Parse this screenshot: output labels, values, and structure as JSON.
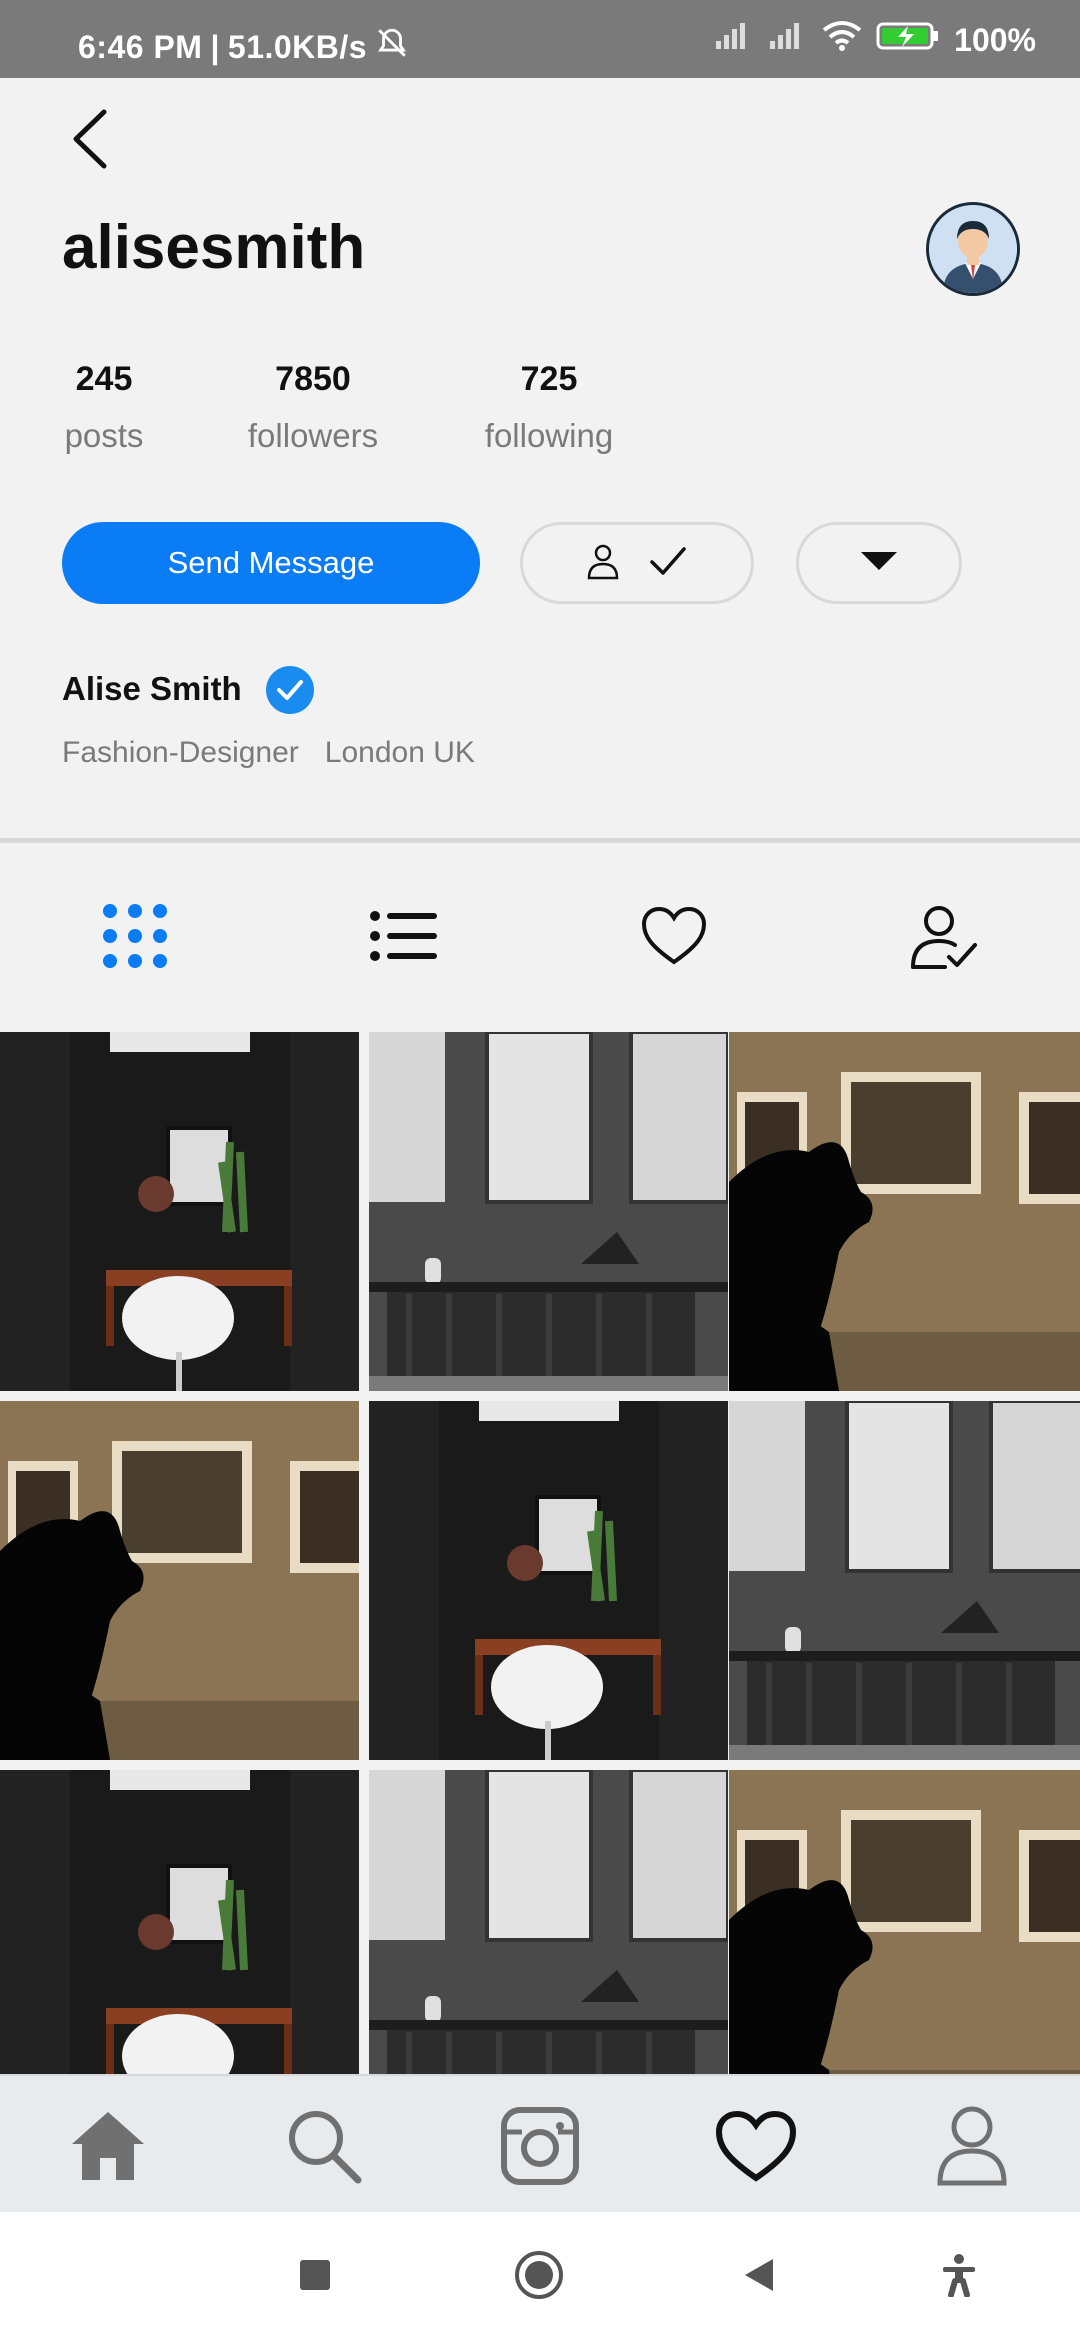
{
  "status_bar": {
    "time": "6:46 PM",
    "net_speed": "51.0KB/s",
    "battery": "100%",
    "icons": [
      "bell-muted-icon",
      "signal-icon",
      "signal-icon",
      "wifi-icon",
      "battery-charging-icon"
    ]
  },
  "header": {
    "back_icon": "chevron-left-icon",
    "username": "alisesmith",
    "avatar_icon": "avatar-businessman-icon"
  },
  "stats": [
    {
      "value": "245",
      "label": "posts"
    },
    {
      "value": "7850",
      "label": "followers"
    },
    {
      "value": "725",
      "label": "following"
    }
  ],
  "actions": {
    "send_message": "Send Message",
    "following_icons": [
      "person-icon",
      "checkmark-icon"
    ],
    "dropdown_icon": "caret-down-icon"
  },
  "profile": {
    "name": "Alise Smith",
    "verified_icon": "verified-check-icon",
    "occupation": "Fashion-Designer",
    "location": "London UK"
  },
  "tabs": [
    {
      "icon": "grid-dots-icon",
      "active": true
    },
    {
      "icon": "list-icon",
      "active": false
    },
    {
      "icon": "heart-icon",
      "active": false
    },
    {
      "icon": "user-check-icon",
      "active": false
    }
  ],
  "grid": {
    "photos": [
      "interior-black-room",
      "interior-grey-frames",
      "silhouette-thinker",
      "silhouette-thinker",
      "interior-black-room",
      "interior-grey-frames",
      "interior-black-room",
      "interior-grey-frames",
      "silhouette-thinker"
    ]
  },
  "bottom_nav": [
    "home-icon",
    "search-icon",
    "camera-icon",
    "heart-icon",
    "profile-icon"
  ],
  "system_nav": [
    "recents-square-icon",
    "home-circle-icon",
    "back-triangle-icon",
    "accessibility-icon"
  ],
  "colors": {
    "accent": "#0a7cf5",
    "verified": "#1a8cf0",
    "muted_text": "#7a7a7a",
    "status_bar": "#7a7a7a"
  }
}
